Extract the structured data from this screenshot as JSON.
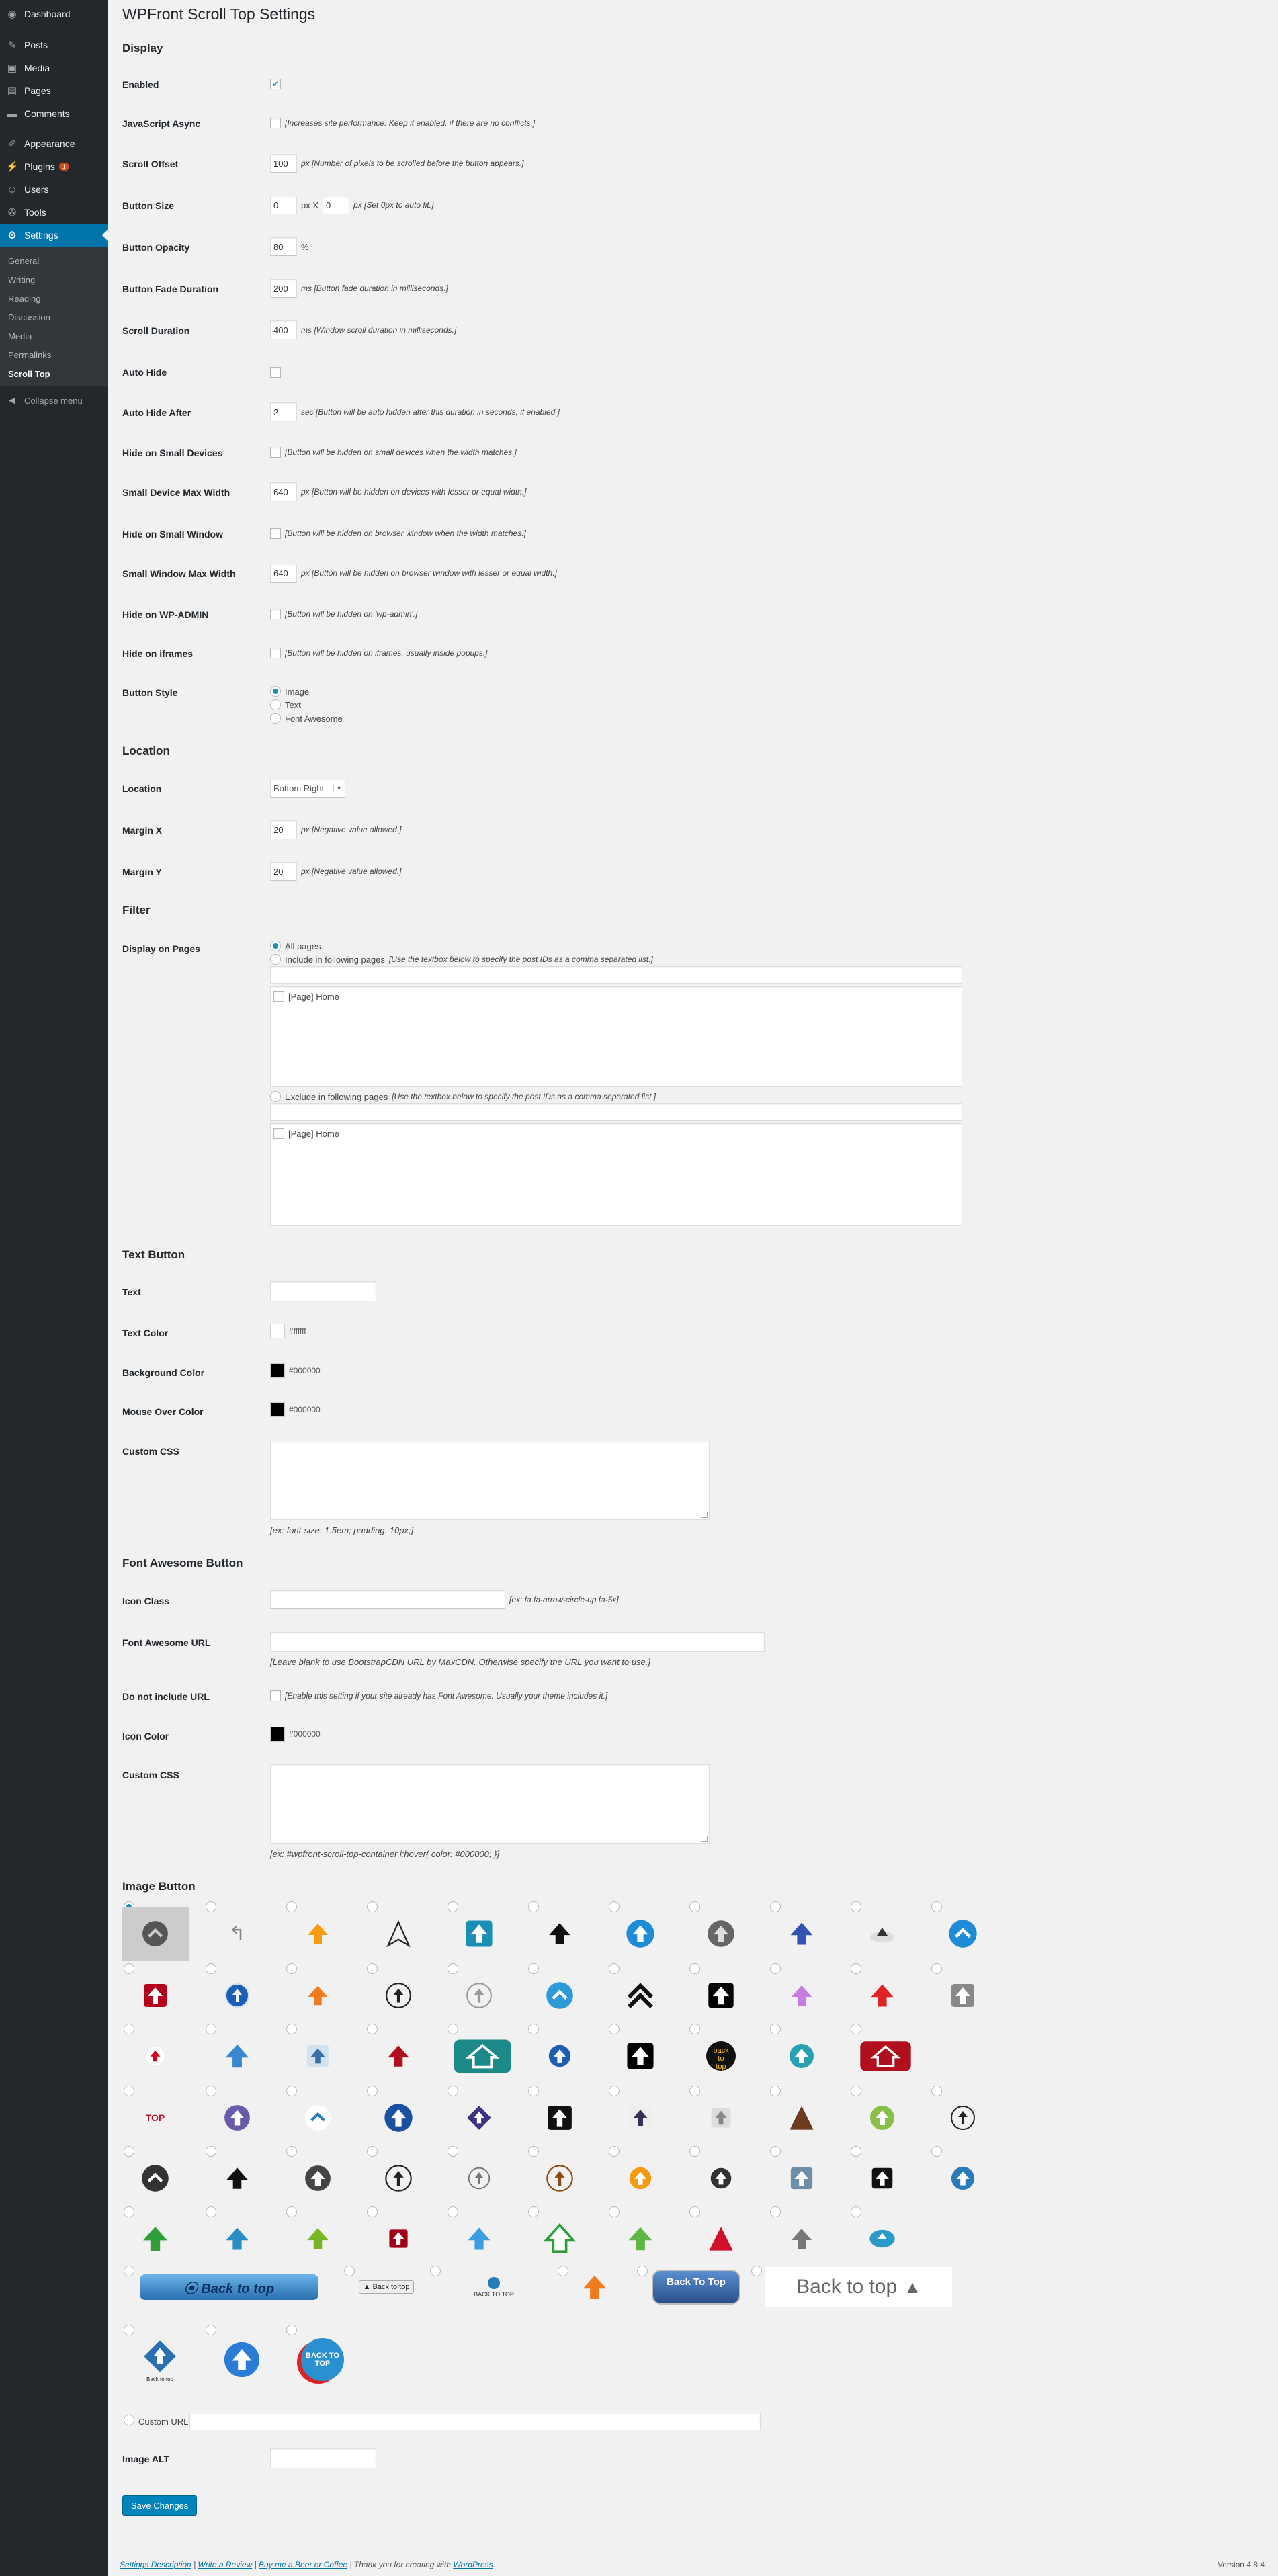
{
  "sidebar": {
    "items": [
      {
        "label": "Dashboard",
        "icon": "dashboard-icon",
        "glyph": "◉"
      },
      {
        "label": "Posts",
        "icon": "pin-icon",
        "glyph": "✎"
      },
      {
        "label": "Media",
        "icon": "media-icon",
        "glyph": "▣"
      },
      {
        "label": "Pages",
        "icon": "pages-icon",
        "glyph": "▤"
      },
      {
        "label": "Comments",
        "icon": "comments-icon",
        "glyph": "▬"
      },
      {
        "label": "Appearance",
        "icon": "brush-icon",
        "glyph": "✐"
      },
      {
        "label": "Plugins",
        "icon": "plug-icon",
        "glyph": "⚡",
        "badge": "1"
      },
      {
        "label": "Users",
        "icon": "users-icon",
        "glyph": "☺"
      },
      {
        "label": "Tools",
        "icon": "wrench-icon",
        "glyph": "✇"
      },
      {
        "label": "Settings",
        "icon": "settings-icon",
        "glyph": "⚙"
      }
    ],
    "submenu": [
      "General",
      "Writing",
      "Reading",
      "Discussion",
      "Media",
      "Permalinks",
      "Scroll Top"
    ],
    "collapse": "Collapse menu"
  },
  "page": {
    "title": "WPFront Scroll Top Settings"
  },
  "display": {
    "heading": "Display",
    "enabled": "Enabled",
    "js_async": "JavaScript Async",
    "js_async_desc": "[Increases site performance. Keep it enabled, if there are no conflicts.]",
    "scroll_offset": "Scroll Offset",
    "scroll_offset_val": "100",
    "scroll_offset_desc": "px [Number of pixels to be scrolled before the button appears.]",
    "button_size": "Button Size",
    "size_w": "0",
    "size_x": "px X",
    "size_h": "0",
    "size_desc": "px [Set 0px to auto fit.]",
    "opacity": "Button Opacity",
    "opacity_val": "80",
    "opacity_unit": "%",
    "fade": "Button Fade Duration",
    "fade_val": "200",
    "fade_desc": "ms [Button fade duration in milliseconds.]",
    "scroll_dur": "Scroll Duration",
    "scroll_dur_val": "400",
    "scroll_dur_desc": "ms [Window scroll duration in milliseconds.]",
    "auto_hide": "Auto Hide",
    "auto_hide_after": "Auto Hide After",
    "auto_hide_val": "2",
    "auto_hide_desc": "sec [Button will be auto hidden after this duration in seconds, if enabled.]",
    "hide_small_dev": "Hide on Small Devices",
    "hide_small_dev_desc": "[Button will be hidden on small devices when the width matches.]",
    "small_dev_w": "Small Device Max Width",
    "small_dev_w_val": "640",
    "small_dev_w_desc": "px [Button will be hidden on devices with lesser or equal width.]",
    "hide_small_win": "Hide on Small Window",
    "hide_small_win_desc": "[Button will be hidden on browser window when the width matches.]",
    "small_win_w": "Small Window Max Width",
    "small_win_w_val": "640",
    "small_win_w_desc": "px [Button will be hidden on browser window with lesser or equal width.]",
    "hide_admin": "Hide on WP-ADMIN",
    "hide_admin_desc": "[Button will be hidden on 'wp-admin'.]",
    "hide_iframe": "Hide on iframes",
    "hide_iframe_desc": "[Button will be hidden on iframes, usually inside popups.]",
    "style": "Button Style",
    "style_opts": [
      "Image",
      "Text",
      "Font Awesome"
    ]
  },
  "location": {
    "heading": "Location",
    "label": "Location",
    "value": "Bottom Right",
    "mx": "Margin X",
    "mx_val": "20",
    "mx_desc": "px [Negative value allowed.]",
    "my": "Margin Y",
    "my_val": "20",
    "my_desc": "px [Negative value allowed.]"
  },
  "filter": {
    "heading": "Filter",
    "label": "Display on Pages",
    "all": "All pages.",
    "include": "Include in following pages",
    "include_desc": "[Use the textbox below to specify the post IDs as a comma separated list.]",
    "exclude": "Exclude in following pages",
    "exclude_desc": "[Use the textbox below to specify the post IDs as a comma separated list.]",
    "page_item": "[Page] Home"
  },
  "text_button": {
    "heading": "Text Button",
    "text": "Text",
    "text_color": "Text Color",
    "text_color_val": "#ffffff",
    "bg_color": "Background Color",
    "bg_color_val": "#000000",
    "hover_color": "Mouse Over Color",
    "hover_color_val": "#000000",
    "css": "Custom CSS",
    "css_desc": "[ex: font-size: 1.5em; padding: 10px;]"
  },
  "fa_button": {
    "heading": "Font Awesome Button",
    "icon_class": "Icon Class",
    "icon_class_desc": "[ex: fa fa-arrow-circle-up fa-5x]",
    "url": "Font Awesome URL",
    "url_desc": "[Leave blank to use BootstrapCDN URL by MaxCDN. Otherwise specify the URL you want to use.]",
    "no_url": "Do not include URL",
    "no_url_desc": "[Enable this setting if your site already has Font Awesome. Usually your theme includes it.]",
    "color": "Icon Color",
    "color_val": "#000000",
    "css": "Custom CSS",
    "css_desc": "[ex: #wpfront-scroll-top-container i:hover{ color: #000000; }]"
  },
  "image_button": {
    "heading": "Image Button",
    "text_images": [
      "Back to top",
      "Back to top",
      "BACK TO TOP",
      "Back To Top",
      "Back to top",
      "Back to top",
      "BACK TO TOP"
    ],
    "custom_url": "Custom URL",
    "alt": "Image ALT"
  },
  "save": "Save Changes",
  "footer": {
    "link1": "Settings Description",
    "sep1": "|",
    "link2": "Write a Review",
    "sep2": "|",
    "link3": "Buy me a Beer or Coffee",
    "thanks": "| Thank you for creating with",
    "wp": "WordPress",
    "dot": ".",
    "version": "Version 4.8.4"
  }
}
